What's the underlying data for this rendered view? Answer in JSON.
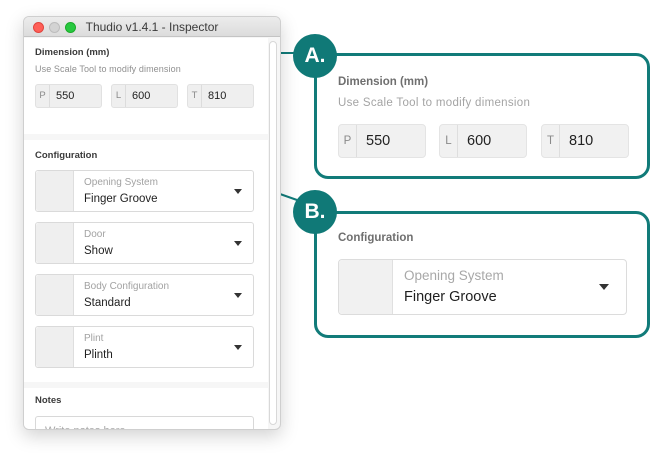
{
  "window": {
    "title": "Thudio v1.4.1 - Inspector"
  },
  "dimension": {
    "title": "Dimension (mm)",
    "hint": "Use Scale Tool to modify dimension",
    "fields": [
      {
        "prefix": "P",
        "value": "550"
      },
      {
        "prefix": "L",
        "value": "600"
      },
      {
        "prefix": "T",
        "value": "810"
      }
    ]
  },
  "configuration": {
    "title": "Configuration",
    "selects": [
      {
        "label": "Opening System",
        "value": "Finger Groove"
      },
      {
        "label": "Door",
        "value": "Show"
      },
      {
        "label": "Body Configuration",
        "value": "Standard"
      },
      {
        "label": "Plint",
        "value": "Plinth"
      }
    ]
  },
  "notes": {
    "title": "Notes",
    "placeholder": "Write notes here..."
  },
  "callouts": {
    "a_label": "A.",
    "b_label": "B."
  },
  "colors": {
    "accent": "#117b79",
    "badge": "#107977"
  }
}
